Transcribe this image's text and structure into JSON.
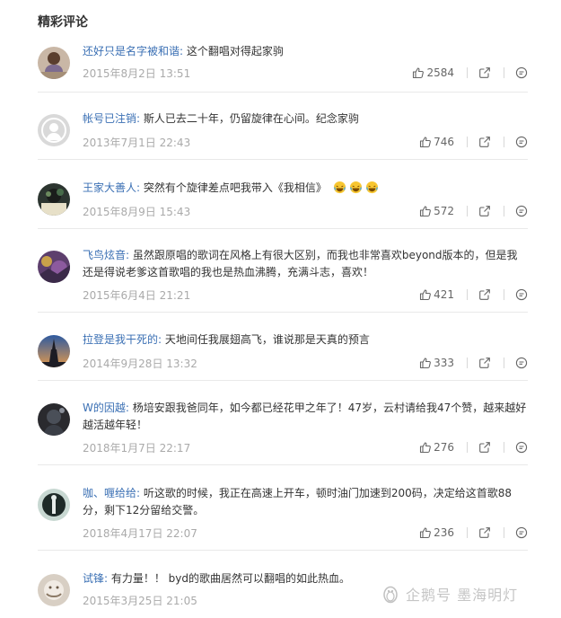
{
  "section_title": "精彩评论",
  "comments": [
    {
      "author": "还好只是名字被和谐:",
      "text": " 这个翻唱对得起家驹",
      "time": "2015年8月2日 13:51",
      "likes": "2584"
    },
    {
      "author": "帐号已注销:",
      "text": " 斯人已去二十年，仍留旋律在心间。纪念家驹",
      "time": "2013年7月1日 22:43",
      "likes": "746"
    },
    {
      "author": "王家大善人:",
      "text": " 突然有个旋律差点吧我带入《我相信》",
      "time": "2015年8月9日 15:43",
      "likes": "572"
    },
    {
      "author": "飞鸟炫音:",
      "text": " 虽然跟原唱的歌词在风格上有很大区别，而我也非常喜欢beyond版本的，但是我还是得说老爹这首歌唱的我也是热血沸腾，充满斗志，喜欢！",
      "time": "2015年6月4日 21:21",
      "likes": "421"
    },
    {
      "author": "拉登是我干死的:",
      "text": " 天地间任我展翅高飞，谁说那是天真的预言",
      "time": "2014年9月28日 13:32",
      "likes": "333"
    },
    {
      "author": "W的因越:",
      "text": " 杨培安跟我爸同年，如今都已经花甲之年了！47岁，云村请给我47个赞，越来越好越活越年轻！",
      "time": "2018年1月7日 22:17",
      "likes": "276"
    },
    {
      "author": "咖、喱给给:",
      "text": " 听这歌的时候，我正在高速上开车，顿时油门加速到200码，决定给这首歌88分，剩下12分留给交警。",
      "time": "2018年4月17日 22:07",
      "likes": "236"
    },
    {
      "author": "试锋:",
      "text": " 有力量！！ byd的歌曲居然可以翻唱的如此热血。",
      "time": "2015年3月25日 21:05",
      "likes": ""
    }
  ],
  "watermark": "企鹅号 墨海明灯",
  "icons": {
    "like": "thumbs-up-icon",
    "share": "share-icon",
    "reply": "comment-bubble-icon",
    "emoji": "laughing-tears-emoji-icon"
  },
  "colors": {
    "author": "#3b70b4",
    "text": "#333333",
    "time": "#aaaaaa",
    "divider": "#e9e9e9"
  }
}
